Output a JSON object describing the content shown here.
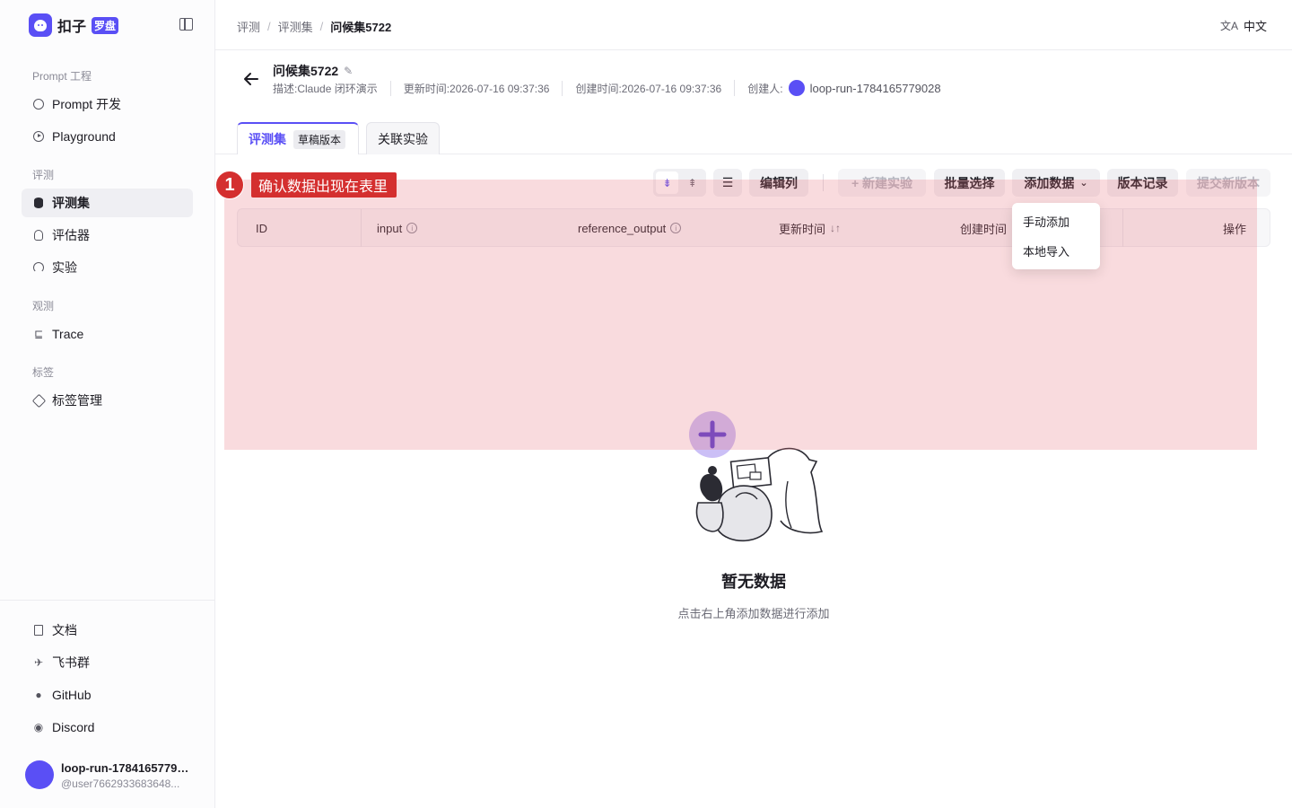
{
  "app": {
    "name": "扣子",
    "badge": "罗盘"
  },
  "sidebar": {
    "sections": [
      {
        "label": "Prompt 工程"
      },
      {
        "label": "评测"
      },
      {
        "label": "观测"
      },
      {
        "label": "标签"
      }
    ],
    "items": [
      {
        "label": "Prompt 开发",
        "icon": "prompt-icon"
      },
      {
        "label": "Playground",
        "icon": "play-icon"
      },
      {
        "label": "评测集",
        "icon": "database-icon",
        "active": true
      },
      {
        "label": "评估器",
        "icon": "bulb-icon"
      },
      {
        "label": "实验",
        "icon": "gauge-icon"
      },
      {
        "label": "Trace",
        "icon": "trace-icon"
      },
      {
        "label": "标签管理",
        "icon": "tag-icon"
      }
    ],
    "footer": [
      {
        "label": "文档",
        "icon": "doc-icon"
      },
      {
        "label": "飞书群",
        "icon": "lark-icon"
      },
      {
        "label": "GitHub",
        "icon": "github-icon"
      },
      {
        "label": "Discord",
        "icon": "discord-icon"
      }
    ],
    "user": {
      "name": "loop-run-1784165779028",
      "handle": "@user7662933683648..."
    }
  },
  "topbar": {
    "breadcrumb": [
      "评测",
      "评测集",
      "问候集5722"
    ],
    "language": "中文"
  },
  "dataset": {
    "name": "问候集5722",
    "description": "描述:Claude 闭环演示",
    "updated": "更新时间:2026-07-16 09:37:36",
    "created": "创建时间:2026-07-16 09:37:36",
    "creator_label": "创建人:",
    "creator": "loop-run-1784165779028"
  },
  "tabs": [
    {
      "label": "评测集",
      "badge": "草稿版本",
      "active": true
    },
    {
      "label": "关联实验"
    }
  ],
  "toolbar": {
    "edit_columns": "编辑列",
    "new_experiment": "+ 新建实验",
    "batch_select": "批量选择",
    "add_data": "添加数据",
    "version_history": "版本记录",
    "submit_version": "提交新版本"
  },
  "add_data_menu": [
    "手动添加",
    "本地导入"
  ],
  "table": {
    "columns": [
      "ID",
      "input",
      "reference_output",
      "更新时间",
      "创建时间",
      "操作"
    ]
  },
  "empty": {
    "title": "暂无数据",
    "subtitle": "点击右上角添加数据进行添加"
  },
  "annotation": {
    "number": "1",
    "text": "确认数据出现在表里",
    "color": "#d42f2f"
  },
  "colors": {
    "accent": "#5a4ff5"
  }
}
